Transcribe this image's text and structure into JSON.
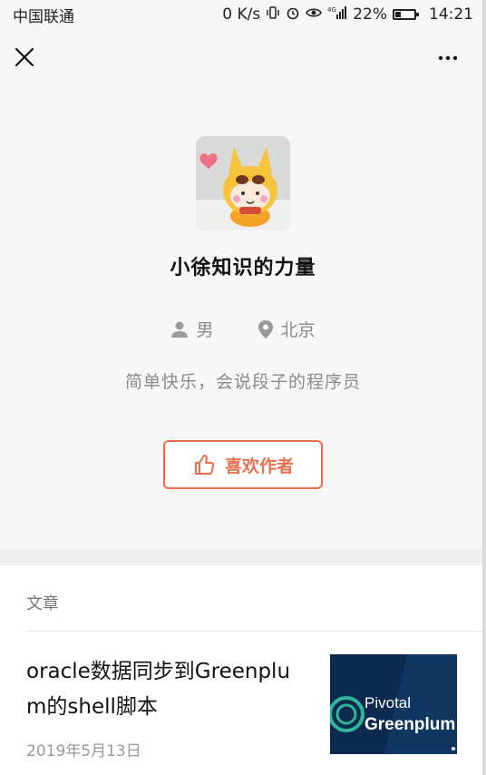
{
  "status": {
    "carrier": "中国联通",
    "speed": "0 K/s",
    "network": "4G",
    "battery": "22%",
    "time": "14:21"
  },
  "profile": {
    "name": "小徐知识的力量",
    "gender": "男",
    "location": "北京",
    "bio": "简单快乐，会说段子的程序员",
    "like_label": "喜欢作者"
  },
  "articles": {
    "section_title": "文章",
    "items": [
      {
        "title": "oracle数据同步到Greenplum的shell脚本",
        "date": "2019年5月13日",
        "thumb_line1": "Pivotal",
        "thumb_line2": "Greenplum"
      }
    ]
  },
  "colors": {
    "accent": "#e8704f",
    "thumb_bg": "#0c2a4d"
  },
  "icons": [
    "close-icon",
    "more-icon",
    "person-icon",
    "location-pin-icon",
    "thumbs-up-icon"
  ]
}
